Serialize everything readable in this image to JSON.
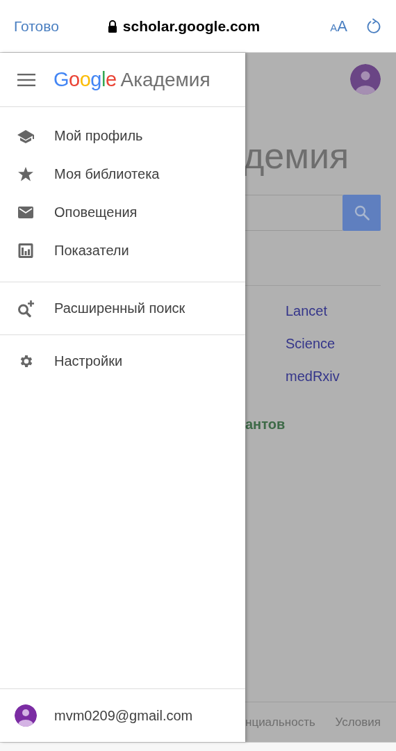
{
  "browser_bar": {
    "done": "Готово",
    "url": "scholar.google.com",
    "text_size_small": "A",
    "text_size_large": "A"
  },
  "drawer": {
    "logo": "Google",
    "title": "Академия",
    "sections": [
      {
        "items": [
          {
            "label": "Мой профиль",
            "kind": "profile"
          },
          {
            "label": "Моя библиотека",
            "kind": "library"
          },
          {
            "label": "Оповещения",
            "kind": "alerts"
          },
          {
            "label": "Показатели",
            "kind": "metrics"
          }
        ]
      },
      {
        "items": [
          {
            "label": "Расширенный поиск",
            "kind": "advanced"
          }
        ]
      },
      {
        "items": [
          {
            "label": "Настройки",
            "kind": "settings"
          }
        ]
      }
    ],
    "account": "mvm0209@gmail.com"
  },
  "page": {
    "heading": "демия",
    "links": [
      "Lancet",
      "Science",
      "medRxiv"
    ],
    "highlight": "антов",
    "footer_links": [
      "нциальность",
      "Условия"
    ]
  }
}
